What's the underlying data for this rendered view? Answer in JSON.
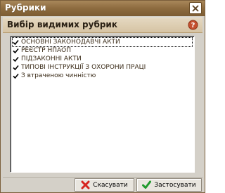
{
  "window": {
    "title": "Рубрики",
    "close_icon": "close-icon"
  },
  "header": {
    "title": "Вибір видимих рубрик",
    "help_icon": "help-icon"
  },
  "rubrics": [
    {
      "label": "ОСНОВНІ ЗАКОНОДАВЧІ АКТИ",
      "checked": true
    },
    {
      "label": "РЕЄСТР НПАОП",
      "checked": true
    },
    {
      "label": "ПІДЗАКОННІ АКТИ",
      "checked": true
    },
    {
      "label": "ТИПОВІ ІНСТРУКЦІЇ З ОХОРОНИ ПРАЦІ",
      "checked": true
    },
    {
      "label": "З втраченою чинністю",
      "checked": true
    }
  ],
  "buttons": {
    "cancel_label": "Скасувати",
    "apply_label": "Застосувати"
  },
  "colors": {
    "titlebar": "#8d6b3f",
    "cancel_icon": "#d6251f",
    "apply_icon": "#1f9a2c"
  }
}
